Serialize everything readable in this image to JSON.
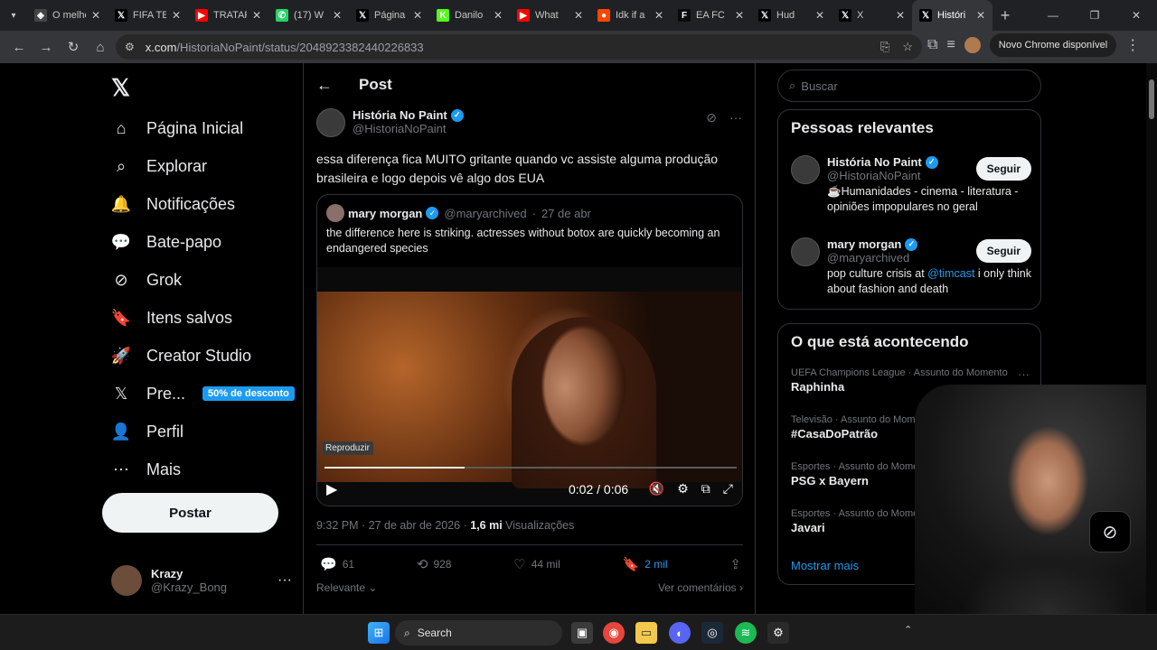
{
  "browser": {
    "tabs": [
      {
        "title": "O melhor",
        "icon": "shield",
        "color": "#444"
      },
      {
        "title": "FIFA TE",
        "icon": "x",
        "color": "#000"
      },
      {
        "title": "TRATAR",
        "icon": "youtube",
        "color": "#ff0000"
      },
      {
        "title": "(17) W",
        "icon": "whatsapp",
        "color": "#25d366"
      },
      {
        "title": "Página",
        "icon": "x",
        "color": "#000"
      },
      {
        "title": "Danilo",
        "icon": "k",
        "color": "#53fc18"
      },
      {
        "title": "What",
        "icon": "youtube",
        "color": "#ff0000"
      },
      {
        "title": "Idk if a",
        "icon": "reddit",
        "color": "#ff4500"
      },
      {
        "title": "EA FC",
        "icon": "futbin",
        "color": "#0a0a0a"
      },
      {
        "title": "Hud",
        "icon": "x",
        "color": "#000"
      },
      {
        "title": "X",
        "icon": "x",
        "color": "#000"
      },
      {
        "title": "Históri",
        "icon": "x",
        "color": "#000",
        "active": true
      }
    ],
    "url_host": "x.com",
    "url_path": "/HistoriaNoPaint/status/2048923382440226833",
    "update_label": "Novo Chrome disponível"
  },
  "nav": {
    "items": [
      {
        "label": "Página Inicial",
        "icon": "home-icon"
      },
      {
        "label": "Explorar",
        "icon": "search-icon"
      },
      {
        "label": "Notificações",
        "icon": "bell-icon"
      },
      {
        "label": "Bate-papo",
        "icon": "chat-icon"
      },
      {
        "label": "Grok",
        "icon": "grok-icon"
      },
      {
        "label": "Itens salvos",
        "icon": "bookmark-icon"
      },
      {
        "label": "Creator Studio",
        "icon": "rocket-icon"
      },
      {
        "label": "Pre...",
        "icon": "x-logo-icon"
      },
      {
        "label": "Perfil",
        "icon": "person-icon"
      },
      {
        "label": "Mais",
        "icon": "more-circle-icon"
      }
    ],
    "premium_badge": "50% de desconto",
    "post_button": "Postar",
    "account_name": "Krazy",
    "account_handle": "@Krazy_Bong"
  },
  "post": {
    "header": "Post",
    "author_name": "História No Paint",
    "author_handle": "@HistoriaNoPaint",
    "text": "essa diferença fica MUITO gritante quando vc assiste alguma produção brasileira e logo depois vê algo dos EUA",
    "quote": {
      "name": "mary morgan",
      "handle": "@maryarchived",
      "date": "27 de abr",
      "text": "the difference here is striking. actresses without botox are quickly becoming an endangered species"
    },
    "video": {
      "tooltip": "Reproduzir",
      "time": "0:02 / 0:06",
      "progress": 0.34
    },
    "time": "9:32 PM · 27 de abr de 2026 · ",
    "views_count": "1,6 mi",
    "views_label": "Visualizações",
    "replies": "61",
    "reposts": "928",
    "likes": "44 mil",
    "bookmarks": "2 mil",
    "sort_label": "Relevante",
    "comments_label": "Ver comentários"
  },
  "sidebar": {
    "search_placeholder": "Buscar",
    "relevant_title": "Pessoas relevantes",
    "follow_label": "Seguir",
    "people": [
      {
        "name": "História No Paint",
        "handle": "@HistoriaNoPaint",
        "bio": "☕Humanidades - cinema - literatura - opiniões impopulares no geral"
      },
      {
        "name": "mary morgan",
        "handle": "@maryarchived",
        "bio_pre": "pop culture crisis at ",
        "bio_link": "@timcast",
        "bio_post": " i only think about fashion and death"
      }
    ],
    "trending_title": "O que está acontecendo",
    "trends": [
      {
        "meta": "UEFA Champions League · Assunto do Momento",
        "topic": "Raphinha"
      },
      {
        "meta": "Televisão · Assunto do Momento",
        "topic": "#CasaDoPatrão"
      },
      {
        "meta": "Esportes · Assunto do Momento",
        "topic": "PSG x Bayern"
      },
      {
        "meta": "Esportes · Assunto do Momento",
        "topic": "Javari"
      }
    ],
    "show_more": "Mostrar mais"
  },
  "taskbar": {
    "search_label": "Search"
  }
}
